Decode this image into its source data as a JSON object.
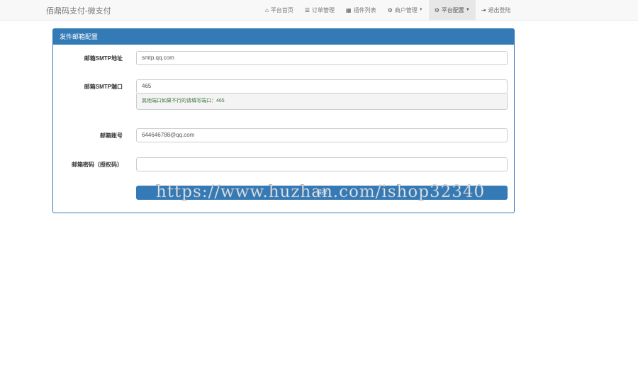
{
  "navbar": {
    "brand": "佰鼎码支付-微支付",
    "items": [
      {
        "label": "平台首页",
        "icon": "home-icon",
        "glyph": "⌂",
        "caret": false,
        "active": false
      },
      {
        "label": "订单管理",
        "icon": "list-icon",
        "glyph": "☰",
        "caret": false,
        "active": false
      },
      {
        "label": "插件列表",
        "icon": "grid-icon",
        "glyph": "▦",
        "caret": false,
        "active": false
      },
      {
        "label": "商户管理",
        "icon": "gear-icon",
        "glyph": "⚙",
        "caret": true,
        "active": false
      },
      {
        "label": "平台配置",
        "icon": "gear-icon",
        "glyph": "⚙",
        "caret": true,
        "active": true
      },
      {
        "label": "退出登陆",
        "icon": "logout-icon",
        "glyph": "⇥",
        "caret": false,
        "active": false
      }
    ]
  },
  "panel": {
    "title": "发件邮箱配置",
    "smtp_host_label": "邮箱SMTP地址",
    "smtp_host_value": "smtp.qq.com",
    "smtp_port_label": "邮箱SMTP端口",
    "smtp_port_value": "465",
    "smtp_port_help": "其他端口如果不行的请填写端口：465",
    "account_label": "邮箱账号",
    "account_value": "644646788@qq.com",
    "password_label": "邮箱密码（授权码）",
    "password_value": "",
    "save_label": "保存"
  },
  "watermark": "https://www.huzhan.com/ishop32340"
}
